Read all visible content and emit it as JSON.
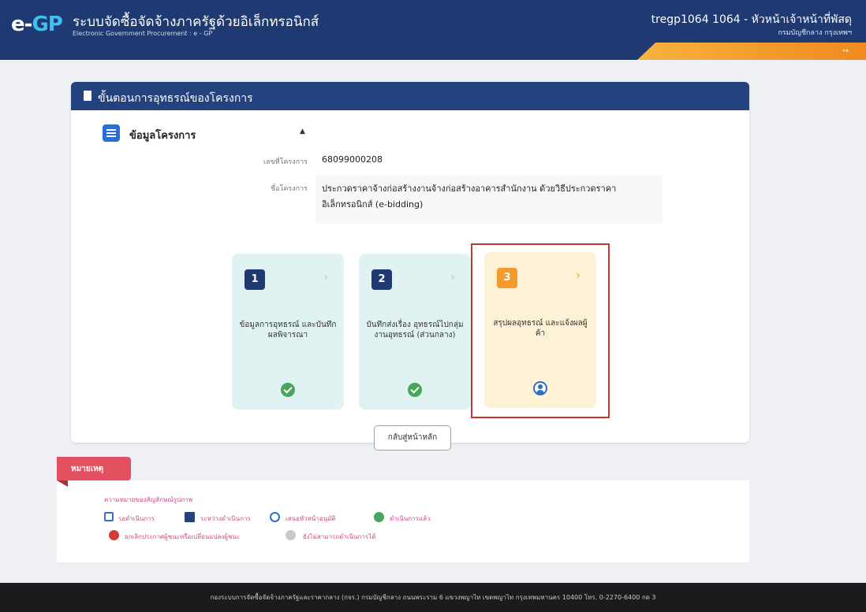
{
  "header": {
    "logo_e": "e-",
    "logo_gp": "GP",
    "title": "ระบบจัดซื้อจัดจ้างภาครัฐด้วยอิเล็กทรอนิกส์",
    "subtitle": "Electronic Government Procurement : e - GP",
    "user": "tregp1064 1064 - หัวหน้าเจ้าหน้าที่พัสดุ",
    "department": "กรมบัญชีกลาง กรุงเทพฯ"
  },
  "card": {
    "header_title": "ขั้นตอนการอุทธรณ์ของโครงการ",
    "section_title": "ข้อมูลโครงการ",
    "fields": {
      "project_no_label": "เลขที่โครงการ",
      "project_no_value": "68099000208",
      "project_name_label": "ชื่อโครงการ",
      "project_name_line1": "ประกวดราคาจ้างก่อสร้างงานจ้างก่อสร้างอาคารสำนักงาน ด้วยวิธีประกวดราคา",
      "project_name_line2": "อิเล็กทรอนิกส์ (e-bidding)"
    }
  },
  "steps": [
    {
      "number": "1",
      "label": "ข้อมูลการอุทธรณ์ และบันทึกผลพิจารณา",
      "status": "done"
    },
    {
      "number": "2",
      "label": "บันทึกส่งเรื่อง อุทธรณ์ไปกลุ่ม งานอุทธรณ์ (ส่วนกลาง)",
      "status": "done"
    },
    {
      "number": "3",
      "label": "สรุปผลอุทธรณ์ และแจ้งผลผู้ค้า",
      "status": "current"
    }
  ],
  "back_button": "กลับสู่หน้าหลัก",
  "remarks": {
    "tab": "หมายเหตุ",
    "legend_title": "ความหมายของสัญลักษณ์รูปภาพ",
    "items": [
      "รอดำเนินการ",
      "ระหว่างดำเนินการ",
      "เสนอหัวหน้าอนุมัติ",
      "ดำเนินการแล้ว",
      "ยกเลิกประกาศผู้ชนะหรือเปลี่ยนแปลงผู้ชนะ",
      "ยังไม่สามารถดำเนินการได้"
    ]
  },
  "footer": "กองระบบการจัดซื้อจัดจ้างภาครัฐและราคากลาง (กจร.) กรมบัญชีกลาง ถนนพระราม 6 แขวงพญาไท เขตพญาไท กรุงเทพมหานคร 10400 โทร. 0-2270-6400 กด 3",
  "colors": {
    "brand_navy": "#1f3a73",
    "accent_orange": "#f59a2c",
    "highlight_red": "#c8332e",
    "done_green": "#47a55c"
  }
}
